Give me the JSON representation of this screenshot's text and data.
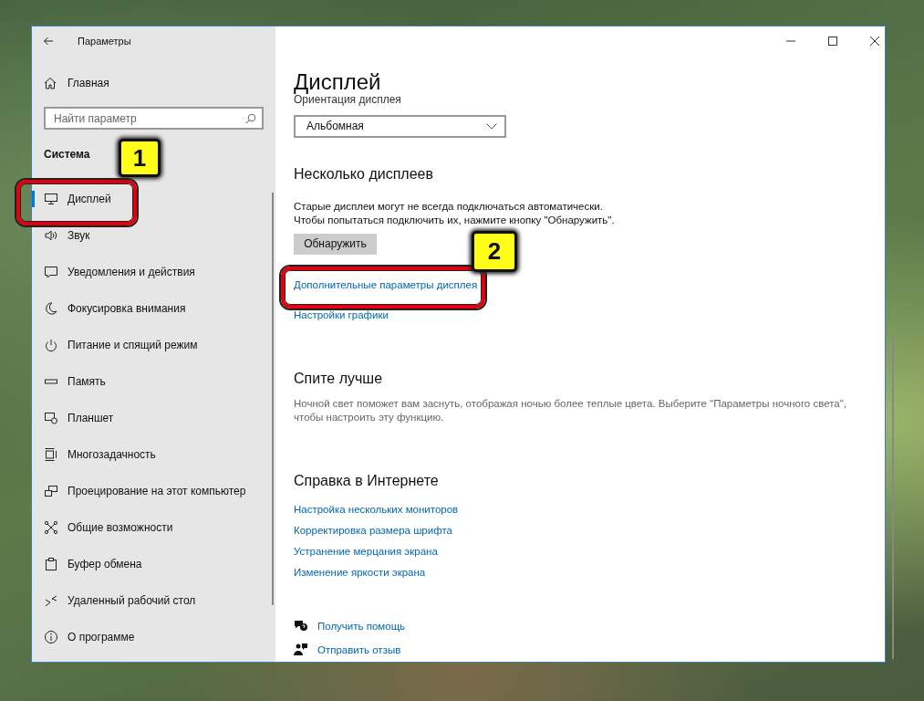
{
  "window": {
    "title": "Параметры"
  },
  "sidebar": {
    "home": "Главная",
    "search": {
      "placeholder": "Найти параметр"
    },
    "section": "Система",
    "items": [
      {
        "label": "Дисплей",
        "selected": true
      },
      {
        "label": "Звук",
        "selected": false
      },
      {
        "label": "Уведомления и действия",
        "selected": false
      },
      {
        "label": "Фокусировка внимания",
        "selected": false
      },
      {
        "label": "Питание и спящий режим",
        "selected": false
      },
      {
        "label": "Память",
        "selected": false
      },
      {
        "label": "Планшет",
        "selected": false
      },
      {
        "label": "Многозадачность",
        "selected": false
      },
      {
        "label": "Проецирование на этот компьютер",
        "selected": false
      },
      {
        "label": "Общие возможности",
        "selected": false
      },
      {
        "label": "Буфер обмена",
        "selected": false
      },
      {
        "label": "Удаленный рабочий стол",
        "selected": false
      },
      {
        "label": "О программе",
        "selected": false
      }
    ]
  },
  "content": {
    "title": "Дисплей",
    "orientation": {
      "label": "Ориентация дисплея",
      "value": "Альбомная"
    },
    "multiple_displays": {
      "heading": "Несколько дисплеев",
      "text_lines": [
        "Старые дисплеи могут не всегда подключаться автоматически.",
        "Чтобы попытаться подключить их, нажмите кнопку \"Обнаружить\"."
      ],
      "button": "Обнаружить",
      "links": [
        "Дополнительные параметры дисплея",
        "Настройки графики"
      ]
    },
    "sleep_better": {
      "heading": "Спите лучше",
      "text": "Ночной свет поможет вам заснуть, отображая ночью более теплые цвета. Выберите \"Параметры ночного света\", чтобы настроить эту функцию."
    },
    "web_help": {
      "heading": "Справка в Интернете",
      "links": [
        "Настройка нескольких мониторов",
        "Корректировка размера шрифта",
        "Устранение мерцания экрана",
        "Изменение яркости экрана"
      ]
    },
    "footer_links": [
      "Получить помощь",
      "Отправить отзыв"
    ]
  },
  "annotations": [
    {
      "label": "1"
    },
    {
      "label": "2"
    }
  ]
}
